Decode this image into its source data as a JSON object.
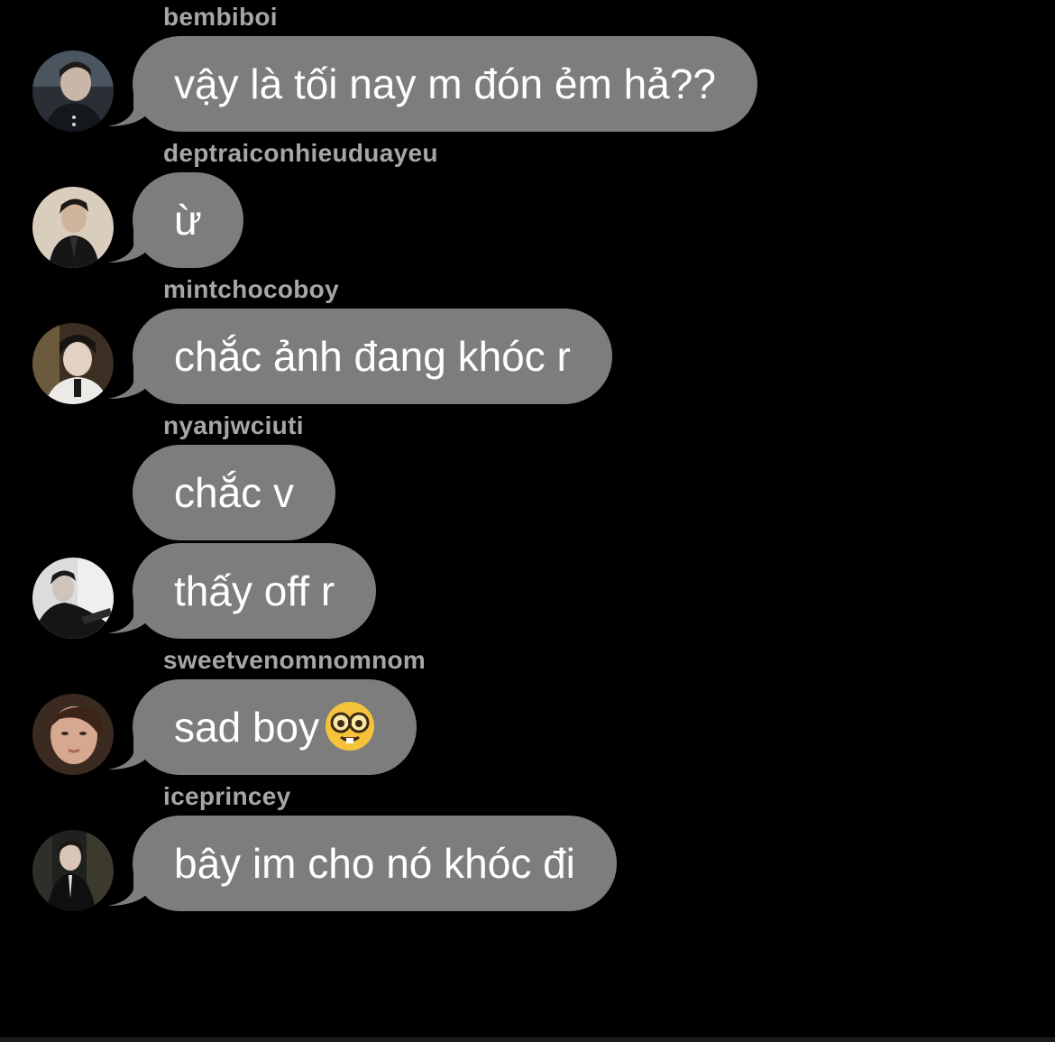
{
  "colors": {
    "background": "#000000",
    "bubble": "#7d7d7d",
    "username": "#a6a6a6",
    "message_text": "#ffffff"
  },
  "messages": [
    {
      "username": "bembiboi",
      "text": "vậy là tối nay m đón ẻm hả??",
      "avatar_icon": "avatar-bembiboi"
    },
    {
      "username": "deptraiconhieuduayeu",
      "text": "ừ",
      "avatar_icon": "avatar-deptraiconhieuduayeu"
    },
    {
      "username": "mintchocoboy",
      "text": "chắc ảnh đang khóc r",
      "avatar_icon": "avatar-mintchocoboy"
    },
    {
      "username": "nyanjwciuti",
      "text": "chắc v",
      "avatar_icon": ""
    },
    {
      "username": "",
      "text": "thấy off r",
      "avatar_icon": "avatar-nyanjwciuti"
    },
    {
      "username": "sweetvenomnomnom",
      "text": "sad boy",
      "emoji": "nerd-face-emoji",
      "avatar_icon": "avatar-sweetvenomnomnom"
    },
    {
      "username": "iceprincey",
      "text": "bây im cho nó khóc đi",
      "avatar_icon": "avatar-iceprincey"
    }
  ]
}
